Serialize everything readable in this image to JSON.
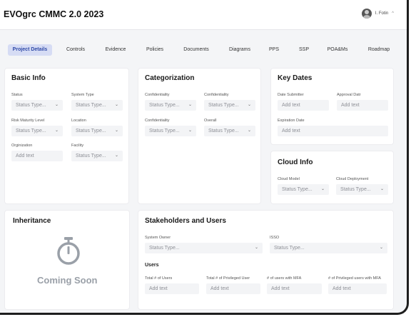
{
  "app": {
    "title": "EVOgrc CMMC 2.0 2023"
  },
  "user": {
    "name": "I. Fotin",
    "avatar_icon": "user-avatar",
    "menu_icon": "chevron-up-icon"
  },
  "tabs": [
    {
      "label": "Project Details",
      "active": true
    },
    {
      "label": "Controls"
    },
    {
      "label": "Evidence"
    },
    {
      "label": "Policies"
    },
    {
      "label": "Documents"
    },
    {
      "label": "Diagrams"
    },
    {
      "label": "PPS"
    },
    {
      "label": "SSP"
    },
    {
      "label": "POA&Ms"
    },
    {
      "label": "Roadmap"
    }
  ],
  "basic_info": {
    "title": "Basic Info",
    "fields": [
      {
        "label": "Status",
        "value": "Status Type...",
        "type": "select"
      },
      {
        "label": "System Type",
        "value": "Status Type...",
        "type": "select"
      },
      {
        "label": "Risk Maturity Level",
        "value": "Status Type...",
        "type": "select"
      },
      {
        "label": "Location",
        "value": "Status Type...",
        "type": "select"
      },
      {
        "label": "Orginization",
        "placeholder": "Add text",
        "type": "text"
      },
      {
        "label": "Facility",
        "value": "Status Type...",
        "type": "select"
      }
    ]
  },
  "categorization": {
    "title": "Categorization",
    "fields": [
      {
        "label": "Confidentiality",
        "value": "Status Type...",
        "type": "select"
      },
      {
        "label": "Confidentiality",
        "value": "Status Type...",
        "type": "select"
      },
      {
        "label": "Confidentiality",
        "value": "Status Type...",
        "type": "select"
      },
      {
        "label": "Overall",
        "value": "Status Type...",
        "type": "select"
      }
    ]
  },
  "key_dates": {
    "title": "Key Dates",
    "fields": [
      {
        "label": "Date Submitter",
        "placeholder": "Add text"
      },
      {
        "label": "Approval Datr",
        "placeholder": "Add text"
      },
      {
        "label": "Expiration Date",
        "placeholder": "Add text"
      }
    ]
  },
  "cloud_info": {
    "title": "Cloud Info",
    "fields": [
      {
        "label": "Cloud Model",
        "value": "Status Type..."
      },
      {
        "label": "Cloud Deployment",
        "value": "Status Type..."
      }
    ]
  },
  "inheritance": {
    "title": "Inheritance",
    "icon": "stopwatch-icon",
    "coming_soon": "Coming Soon"
  },
  "stakeholders": {
    "title": "Stakeholders and Users",
    "fields": [
      {
        "label": "System Owner",
        "value": "Status Type..."
      },
      {
        "label": "ISSO",
        "value": "Status Type..."
      }
    ],
    "users_heading": "Users",
    "user_fields": [
      {
        "label": "Total # of Users",
        "placeholder": "Add text"
      },
      {
        "label": "Total # of Privileged User",
        "placeholder": "Add text"
      },
      {
        "label": "# of users with MFA",
        "placeholder": "Add text"
      },
      {
        "label": "# of Privileged users with MFA",
        "placeholder": "Add text"
      }
    ]
  },
  "colors": {
    "accent": "#2f49a7",
    "accent_bg": "#d6dcf4",
    "background": "#f4f5f7",
    "card": "#ffffff",
    "field": "#f3f4f6"
  }
}
